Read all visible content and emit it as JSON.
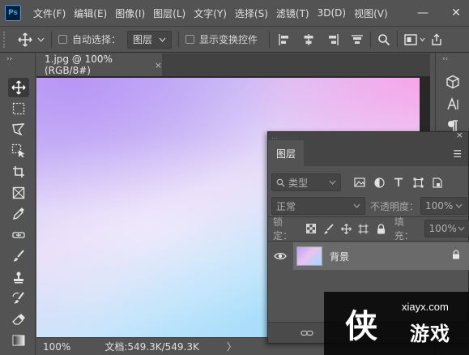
{
  "app": {
    "logo": "Ps"
  },
  "menu": [
    "文件(F)",
    "编辑(E)",
    "图像(I)",
    "图层(L)",
    "文字(Y)",
    "选择(S)",
    "滤镜(T)",
    "3D(D)",
    "视图(V)"
  ],
  "window_controls": {
    "minimize": "—",
    "close": "✕"
  },
  "options": {
    "auto_select_label": "自动选择：",
    "auto_select_value": "图层",
    "show_transform_label": "显示变换控件"
  },
  "document": {
    "tab_title": "1.jpg @ 100%(RGB/8#)",
    "tab_close": "×"
  },
  "status": {
    "zoom": "100%",
    "doc_info": "文档:549.3K/549.3K",
    "arrow": "〉"
  },
  "layers_panel": {
    "tab_label": "图层",
    "filter_kind": "类型",
    "blend_mode": "正常",
    "opacity_label": "不透明度：",
    "opacity_value": "100%",
    "lock_label": "锁定：",
    "fill_label": "填充：",
    "fill_value": "100%",
    "layers": [
      {
        "name": "背景",
        "visible": true,
        "locked": true
      }
    ]
  },
  "watermark": {
    "url": "xiayx.com",
    "glyph": "侠",
    "text": "游戏"
  },
  "colors": {
    "ui_bg": "#535353",
    "canvas_bg": "#282828",
    "canvas_purple": "#b896f5",
    "canvas_pink": "#f7a5e9",
    "canvas_blue": "#a6dcfb"
  }
}
